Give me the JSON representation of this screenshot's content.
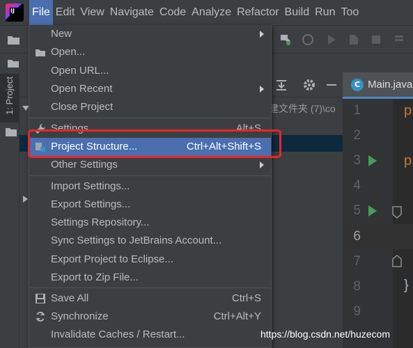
{
  "menubar": {
    "items": [
      "File",
      "Edit",
      "View",
      "Navigate",
      "Code",
      "Analyze",
      "Refactor",
      "Build",
      "Run",
      "Too"
    ],
    "active_index": 0
  },
  "project_tool": {
    "stripe_label": "1: Project",
    "path_fragment": "建文件夹 (7)\\co"
  },
  "editor": {
    "tab_label": "Main.java",
    "class_icon_letter": "C",
    "line_numbers": [
      "1",
      "2",
      "3",
      "4",
      "5",
      "6",
      "7",
      "8",
      "9"
    ],
    "current_line": "6",
    "code_fragments": [
      "p",
      "p",
      "}"
    ]
  },
  "file_menu": {
    "items": [
      {
        "label": "New",
        "shortcut": "",
        "submenu": true,
        "icon": ""
      },
      {
        "label": "Open...",
        "shortcut": "",
        "submenu": false,
        "icon": "folder-icon"
      },
      {
        "label": "Open URL...",
        "shortcut": "",
        "submenu": false,
        "icon": ""
      },
      {
        "label": "Open Recent",
        "shortcut": "",
        "submenu": true,
        "icon": ""
      },
      {
        "label": "Close Project",
        "shortcut": "",
        "submenu": false,
        "icon": ""
      },
      {
        "label": "Settings...",
        "shortcut": "Alt+S",
        "submenu": false,
        "icon": "wrench-icon"
      },
      {
        "label": "Project Structure...",
        "shortcut": "Ctrl+Alt+Shift+S",
        "submenu": false,
        "icon": "project-structure-icon",
        "highlighted": true
      },
      {
        "label": "Other Settings",
        "shortcut": "",
        "submenu": true,
        "icon": ""
      },
      {
        "label": "Import Settings...",
        "shortcut": "",
        "submenu": false,
        "icon": ""
      },
      {
        "label": "Export Settings...",
        "shortcut": "",
        "submenu": false,
        "icon": ""
      },
      {
        "label": "Settings Repository...",
        "shortcut": "",
        "submenu": false,
        "icon": ""
      },
      {
        "label": "Sync Settings to JetBrains Account...",
        "shortcut": "",
        "submenu": false,
        "icon": ""
      },
      {
        "label": "Export Project to Eclipse...",
        "shortcut": "",
        "submenu": false,
        "icon": ""
      },
      {
        "label": "Export to Zip File...",
        "shortcut": "",
        "submenu": false,
        "icon": ""
      },
      {
        "label": "Save All",
        "shortcut": "Ctrl+S",
        "submenu": false,
        "icon": "save-icon"
      },
      {
        "label": "Synchronize",
        "shortcut": "Ctrl+Alt+Y",
        "submenu": false,
        "icon": "sync-icon"
      },
      {
        "label": "Invalidate Caches / Restart...",
        "shortcut": "",
        "submenu": false,
        "icon": ""
      }
    ]
  },
  "watermark": "https://blog.csdn.net/huzecom",
  "colors": {
    "menu_bg": "#3c3f41",
    "selection": "#4b6eaf",
    "annotation_red": "#e8262a",
    "run_green": "#499c54"
  }
}
